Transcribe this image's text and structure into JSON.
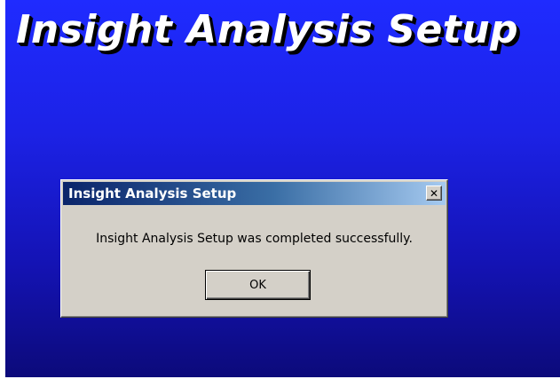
{
  "installer": {
    "banner_title": "Insight Analysis Setup",
    "background_color_top": "#1f2bff",
    "background_color_bottom": "#0c0a7a",
    "banner_text_color": "#ffffff"
  },
  "dialog": {
    "title": "Insight Analysis Setup",
    "close_icon": "close-icon",
    "close_glyph": "✕",
    "message": "Insight Analysis Setup was completed successfully.",
    "ok_label": "OK",
    "titlebar_color": "#0a246a",
    "face_color": "#d4d0c8"
  }
}
